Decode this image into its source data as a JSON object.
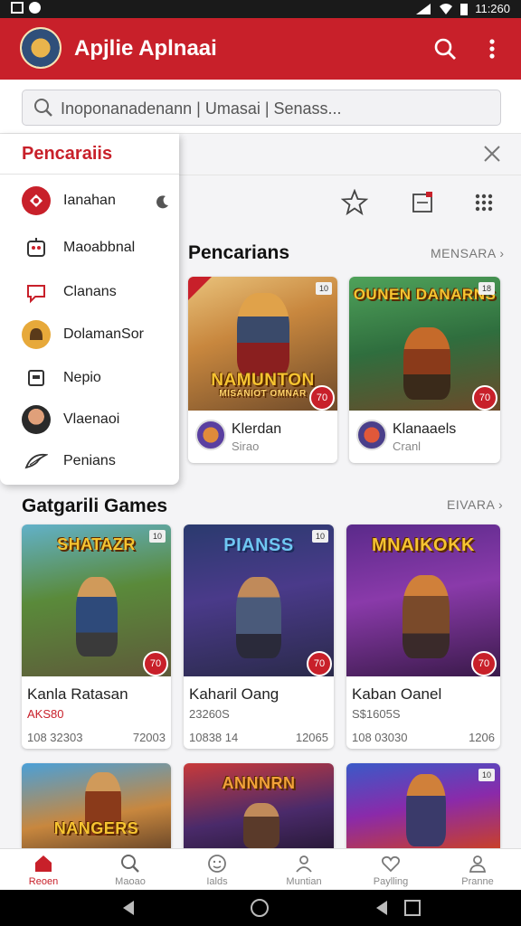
{
  "status": {
    "time": "11:260"
  },
  "app_bar": {
    "title": "Apjlie Aplnaai"
  },
  "search": {
    "text": "Inoponanadenann | Umasai | Senass..."
  },
  "dropdown": {
    "title": "Pencaraiis",
    "items": [
      {
        "label": "Ianahan",
        "icon": "red-emblem-icon"
      },
      {
        "label": "Maoabbnal",
        "icon": "robot-icon"
      },
      {
        "label": "Clanans",
        "icon": "chat-icon"
      },
      {
        "label": "DolamanSor",
        "icon": "helmet-icon"
      },
      {
        "label": "Nepio",
        "icon": "document-icon"
      },
      {
        "label": "Vlaenaoi",
        "icon": "portrait-icon"
      },
      {
        "label": "Penians",
        "icon": "wing-icon"
      }
    ]
  },
  "section1": {
    "title": "Pencarians",
    "see_all": "MENSARA",
    "cards": [
      {
        "art_title": "NAMUNTON",
        "art_sub": "MISANIOT OMNAR",
        "tag": "10",
        "badge": "70",
        "name": "Klerdan",
        "sub": "Sirao"
      },
      {
        "art_title": "OUNEN DANARNS",
        "tag": "18",
        "badge": "70",
        "name": "Klanaaels",
        "sub": "Cranl"
      }
    ]
  },
  "section2": {
    "title": "Gatgarili Games",
    "see_all": "EIVARA",
    "cards": [
      {
        "art_title": "SHATAZR",
        "tag": "10",
        "badge": "70",
        "name": "Kanla Ratasan",
        "price": "AKS80",
        "meta_left": "108 32303",
        "meta_right": "72003"
      },
      {
        "art_title": "PIANSS",
        "tag": "10",
        "badge": "70",
        "name": "Kaharil Oang",
        "price": "23260S",
        "meta_left": "10838 14",
        "meta_right": "12065"
      },
      {
        "art_title": "MNAIKOKK",
        "tag": "10",
        "badge": "70",
        "name": "Kaban Oanel",
        "price": "S$1605S",
        "meta_left": "108 03030",
        "meta_right": "1206"
      }
    ]
  },
  "section3": {
    "cards": [
      {
        "art_title": "NANGERS"
      },
      {
        "art_title": "ANNNRN"
      },
      {
        "art_title": "",
        "tag": "10"
      }
    ]
  },
  "bottom_nav": [
    {
      "label": "Reoen",
      "icon": "home-icon"
    },
    {
      "label": "Maoao",
      "icon": "search-icon"
    },
    {
      "label": "Ialds",
      "icon": "smile-icon"
    },
    {
      "label": "Muntian",
      "icon": "person-icon"
    },
    {
      "label": "Paylling",
      "icon": "heart-icon"
    },
    {
      "label": "Pranne",
      "icon": "profile-icon"
    }
  ],
  "colors": {
    "accent": "#c8202a",
    "background": "#f4f4f6"
  }
}
